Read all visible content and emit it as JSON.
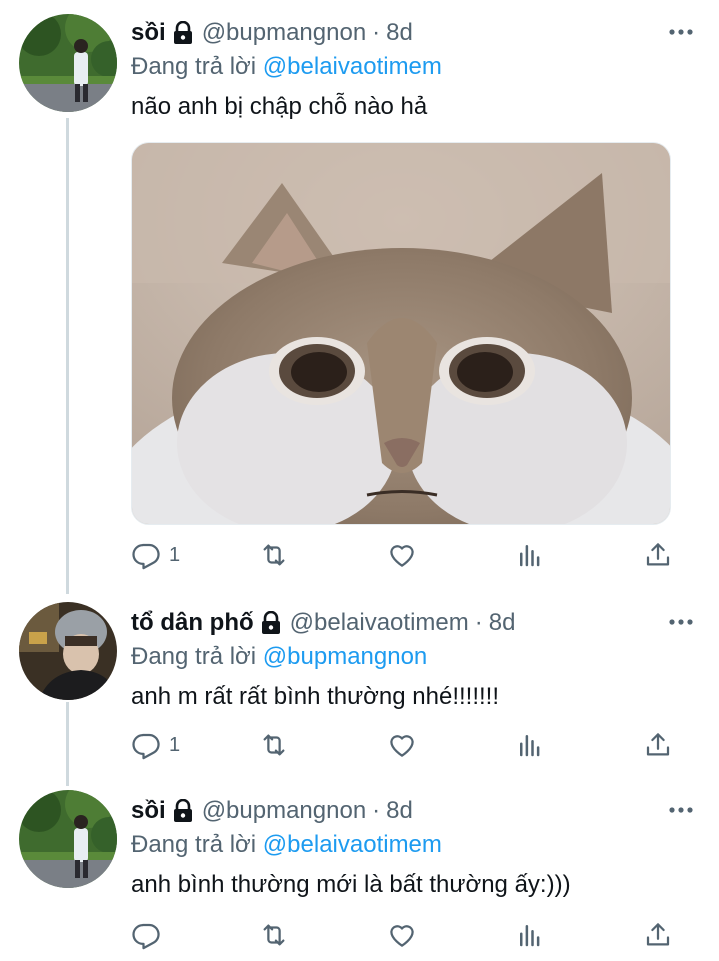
{
  "tweets": [
    {
      "name": "sồi",
      "handle": "@bupmangnon",
      "dot": "·",
      "time": "8d",
      "reply_prefix": "Đang trả lời",
      "reply_mention": "@belaivaotimem",
      "text": "não anh bị chập chỗ nào hả",
      "has_media": true,
      "reply_count": "1"
    },
    {
      "name": "tổ dân phố",
      "handle": "@belaivaotimem",
      "dot": "·",
      "time": "8d",
      "reply_prefix": "Đang trả lời",
      "reply_mention": "@bupmangnon",
      "text": "anh m rất rất bình thường nhé!!!!!!!",
      "has_media": false,
      "reply_count": "1"
    },
    {
      "name": "sồi",
      "handle": "@bupmangnon",
      "dot": "·",
      "time": "8d",
      "reply_prefix": "Đang trả lời",
      "reply_mention": "@belaivaotimem",
      "text": "anh bình thường mới là bất thường ấy:)))",
      "has_media": false,
      "reply_count": ""
    }
  ],
  "colors": {
    "accent": "#1d9bf0",
    "secondary_text": "#536471",
    "thread_line": "#cfd9de"
  },
  "icons": [
    "lock-icon",
    "more-icon",
    "reply-icon",
    "retweet-icon",
    "like-icon",
    "analytics-icon",
    "share-icon"
  ]
}
